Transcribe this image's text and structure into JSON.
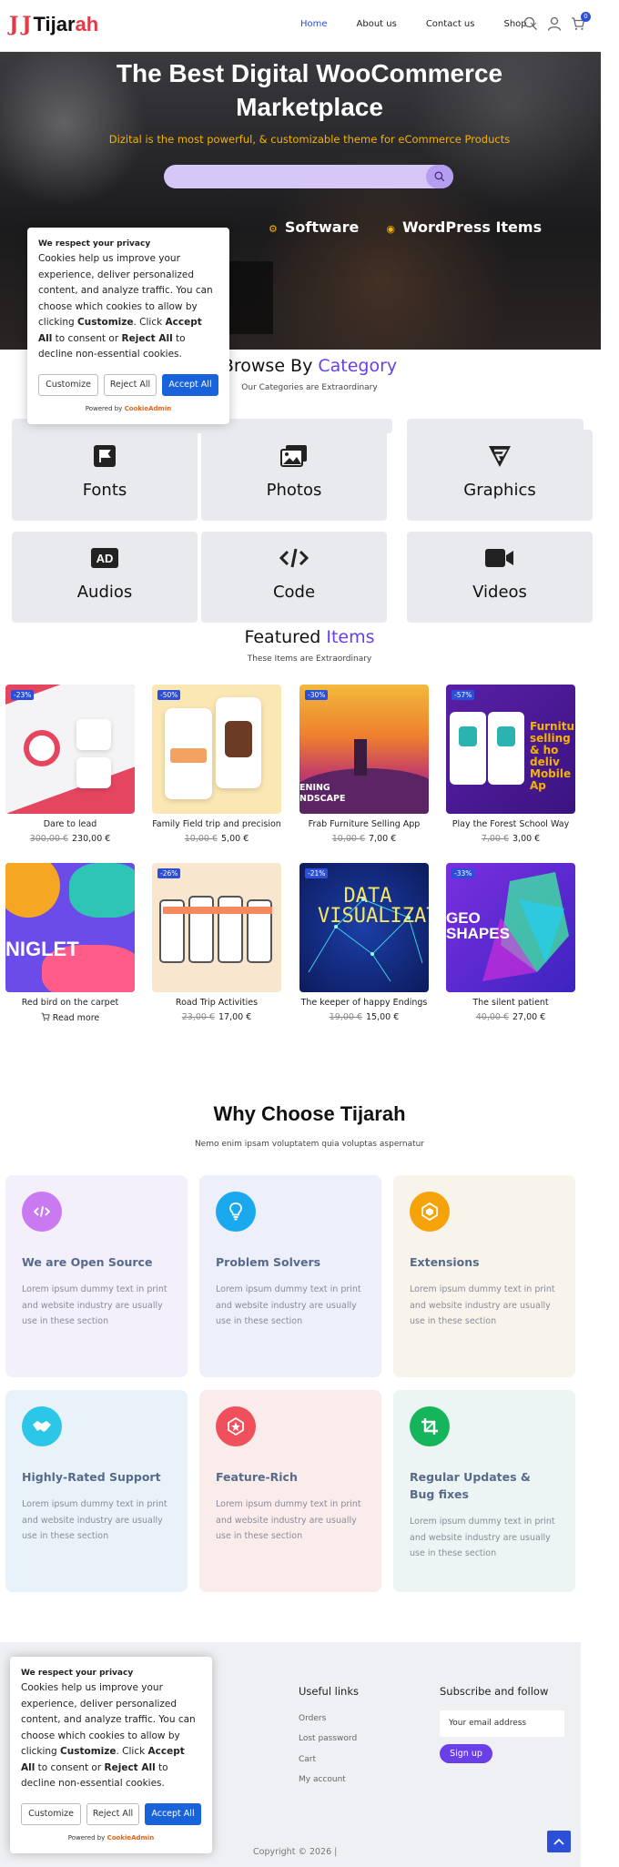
{
  "header": {
    "logo_mark": "J J",
    "logo_prefix": "Tijar",
    "logo_suffix": "ah",
    "nav": [
      {
        "label": "Home"
      },
      {
        "label": "About us"
      },
      {
        "label": "Contact us"
      },
      {
        "label": "Shop"
      }
    ],
    "cart_count": "0"
  },
  "hero": {
    "title_line1": "The Best Digital WooCommerce",
    "title_line2": "Marketplace",
    "subtitle": "Dizital is the most powerful, & customizable theme for eCommerce Products",
    "tags": [
      "Software",
      "WordPress Items"
    ]
  },
  "cookie": {
    "title": "We respect your privacy",
    "text_a": "Cookies help us improve your experience, deliver personalized content, and analyze traffic. You can choose which cookies to allow by clicking ",
    "text_b": "Customize",
    "text_c": ". Click ",
    "text_d": "Accept All",
    "text_e": " to consent or ",
    "text_f": "Reject All",
    "text_g": " to decline non-essential cookies.",
    "customize": "Customize",
    "reject": "Reject All",
    "accept": "Accept All",
    "powered_prefix": "Powered by",
    "powered_brand": "CookieAdmin"
  },
  "category": {
    "title_a": "Browse By ",
    "title_b": "Category",
    "subtitle": "Our Categories are Extraordinary",
    "items": [
      {
        "label": "Fonts",
        "icon": "flag-icon"
      },
      {
        "label": "Photos",
        "icon": "images-icon"
      },
      {
        "label": "Graphics",
        "icon": "graphics-icon"
      },
      {
        "label": "Audios",
        "icon": "ad-icon"
      },
      {
        "label": "Code",
        "icon": "code-icon"
      },
      {
        "label": "Videos",
        "icon": "video-icon"
      }
    ]
  },
  "featured": {
    "title_a": "Featured ",
    "title_b": "Items",
    "subtitle": "These Items are Extraordinary",
    "products": [
      {
        "name": "Dare to lead",
        "old": "300,00 €",
        "price": "230,00 €",
        "badge": "-23%"
      },
      {
        "name": "Family Field trip and precision",
        "old": "10,00 €",
        "price": "5,00 €",
        "badge": "-50%"
      },
      {
        "name": "Frab Furniture Selling App",
        "old": "10,00 €",
        "price": "7,00 €",
        "badge": "-30%",
        "img_text": "ENING\nNDSCAPE"
      },
      {
        "name": "Play the Forest School Way",
        "old": "7,00 €",
        "price": "3,00 €",
        "badge": "-57%",
        "img_text": "Furnitu selling & ho deliv Mobile Ap"
      },
      {
        "name": "Red bird on the carpet",
        "read_more": "Read more",
        "img_text": "NIGLET"
      },
      {
        "name": "Road Trip Activities",
        "old": "23,00 €",
        "price": "17,00 €",
        "badge": "-26%"
      },
      {
        "name": "The keeper of happy Endings",
        "old": "19,00 €",
        "price": "15,00 €",
        "badge": "-21%",
        "img_text": "DATA VISUALIZATION"
      },
      {
        "name": "The silent patient",
        "old": "40,00 €",
        "price": "27,00 €",
        "badge": "-33%",
        "img_text": "GEO SHAPES"
      }
    ]
  },
  "why": {
    "title": "Why Choose Tijarah",
    "subtitle": "Nemo enim ipsam voluptatem quia voluptas aspernatur",
    "cards": [
      {
        "title": "We are Open Source",
        "desc": "Lorem ipsum dummy text in print and website industry are usually use in these section",
        "icon": "code-icon",
        "color": "#c97af0",
        "bg": "#f3effb"
      },
      {
        "title": "Problem Solvers",
        "desc": "Lorem ipsum dummy text in print and website industry are usually use in these section",
        "icon": "lightbulb-icon",
        "color": "#1aa8ee",
        "bg": "#edf0fa"
      },
      {
        "title": "Extensions",
        "desc": "Lorem ipsum dummy text in print and website industry are usually use in these section",
        "icon": "puzzle-icon",
        "color": "#f6a30b",
        "bg": "#f8f4ec"
      },
      {
        "title": "Highly-Rated Support",
        "desc": "Lorem ipsum dummy text in print and website industry are usually use in these section",
        "icon": "handshake-icon",
        "color": "#2cc7e8",
        "bg": "#eaf2f9"
      },
      {
        "title": "Feature-Rich",
        "desc": "Lorem ipsum dummy text in print and website industry are usually use in these section",
        "icon": "star-icon",
        "color": "#f0505c",
        "bg": "#fbecec"
      },
      {
        "title": "Regular Updates & Bug fixes",
        "desc": "Lorem ipsum dummy text in print and website industry are usually use in these section",
        "icon": "crop-icon",
        "color": "#15b55c",
        "bg": "#ecf5f3"
      }
    ]
  },
  "footer": {
    "useful_title": "Useful links",
    "links": [
      "Orders",
      "Lost password",
      "Cart",
      "My account"
    ],
    "subscribe_title": "Subscribe and follow",
    "email_placeholder": "Your email address",
    "signup": "Sign up",
    "copyright": "Copyright © 2026 |"
  }
}
